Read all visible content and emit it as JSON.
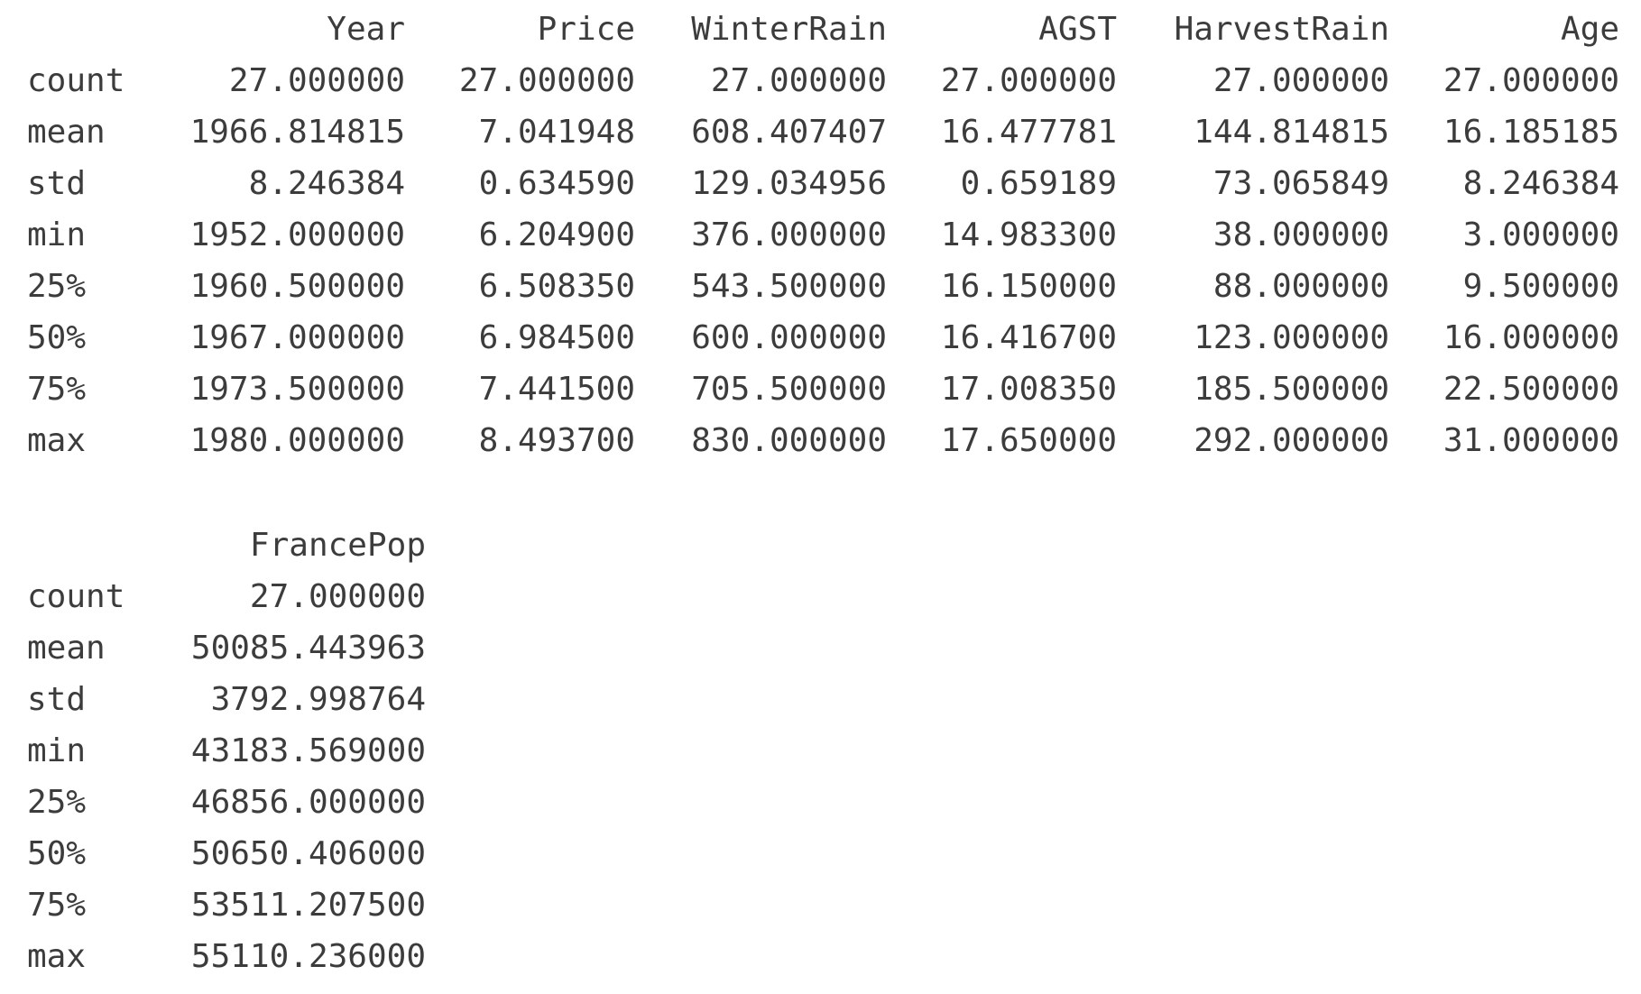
{
  "table1": {
    "columns": [
      "Year",
      "Price",
      "WinterRain",
      "AGST",
      "HarvestRain",
      "Age"
    ],
    "rows": [
      {
        "label": "count",
        "values": [
          "27.000000",
          "27.000000",
          "27.000000",
          "27.000000",
          "27.000000",
          "27.000000"
        ]
      },
      {
        "label": "mean",
        "values": [
          "1966.814815",
          "7.041948",
          "608.407407",
          "16.477781",
          "144.814815",
          "16.185185"
        ]
      },
      {
        "label": "std",
        "values": [
          "8.246384",
          "0.634590",
          "129.034956",
          "0.659189",
          "73.065849",
          "8.246384"
        ]
      },
      {
        "label": "min",
        "values": [
          "1952.000000",
          "6.204900",
          "376.000000",
          "14.983300",
          "38.000000",
          "3.000000"
        ]
      },
      {
        "label": "25%",
        "values": [
          "1960.500000",
          "6.508350",
          "543.500000",
          "16.150000",
          "88.000000",
          "9.500000"
        ]
      },
      {
        "label": "50%",
        "values": [
          "1967.000000",
          "6.984500",
          "600.000000",
          "16.416700",
          "123.000000",
          "16.000000"
        ]
      },
      {
        "label": "75%",
        "values": [
          "1973.500000",
          "7.441500",
          "705.500000",
          "17.008350",
          "185.500000",
          "22.500000"
        ]
      },
      {
        "label": "max",
        "values": [
          "1980.000000",
          "8.493700",
          "830.000000",
          "17.650000",
          "292.000000",
          "31.000000"
        ]
      }
    ]
  },
  "table2": {
    "columns": [
      "FrancePop"
    ],
    "rows": [
      {
        "label": "count",
        "values": [
          "27.000000"
        ]
      },
      {
        "label": "mean",
        "values": [
          "50085.443963"
        ]
      },
      {
        "label": "std",
        "values": [
          "3792.998764"
        ]
      },
      {
        "label": "min",
        "values": [
          "43183.569000"
        ]
      },
      {
        "label": "25%",
        "values": [
          "46856.000000"
        ]
      },
      {
        "label": "50%",
        "values": [
          "50650.406000"
        ]
      },
      {
        "label": "75%",
        "values": [
          "53511.207500"
        ]
      },
      {
        "label": "max",
        "values": [
          "55110.236000"
        ]
      }
    ]
  }
}
